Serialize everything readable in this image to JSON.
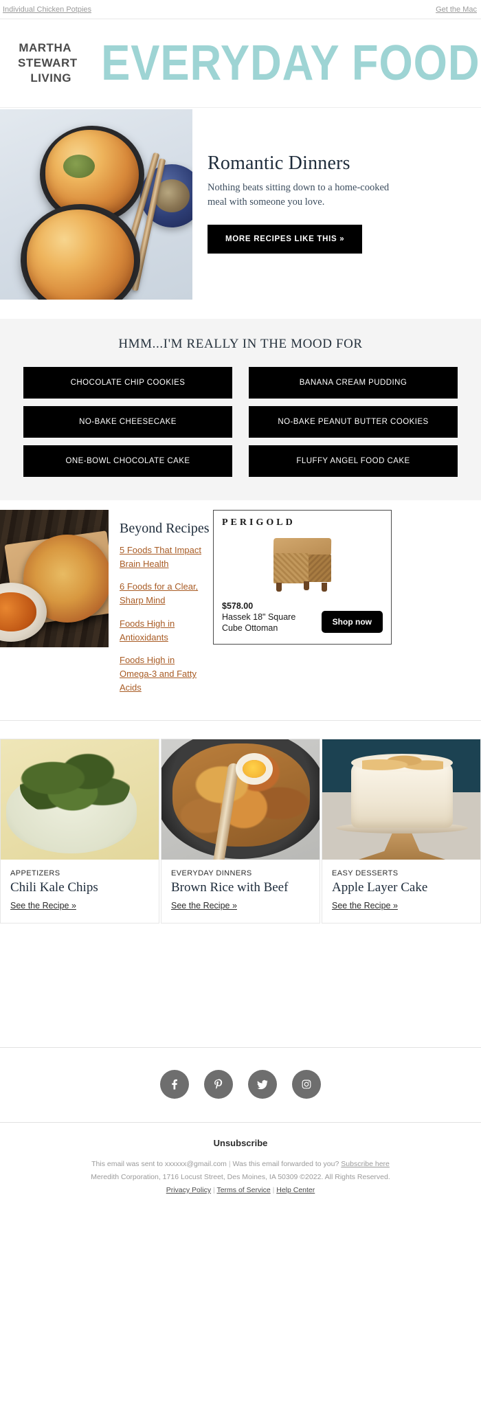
{
  "preheader": {
    "left_text": "Individual Chicken Potpies",
    "right_text": "Get the Mac"
  },
  "masthead": {
    "brand_line1": "MARTHA",
    "brand_line2": "STEWART",
    "brand_line3": "LIVING",
    "publication": "EVERYDAY FOOD",
    "accent_color": "#9ed4d4"
  },
  "hero": {
    "title": "Romantic Dinners",
    "subtitle": "Nothing beats sitting down to a home-cooked meal with someone you love.",
    "cta_label": "MORE RECIPES LIKE THIS »",
    "image_alt": "Individual chicken potpies in cast iron skillets"
  },
  "mood": {
    "heading": "HMM...I'M REALLY IN THE MOOD FOR",
    "buttons": [
      {
        "label": "CHOCOLATE CHIP COOKIES"
      },
      {
        "label": "BANANA CREAM PUDDING"
      },
      {
        "label": "NO-BAKE CHEESECAKE"
      },
      {
        "label": "NO-BAKE PEANUT BUTTER COOKIES"
      },
      {
        "label": "ONE-BOWL CHOCOLATE CAKE"
      },
      {
        "label": "FLUFFY ANGEL FOOD CAKE"
      }
    ]
  },
  "beyond": {
    "title": "Beyond Recipes",
    "image_alt": "Pizza on a wooden board with chicken wings",
    "links": [
      {
        "label": "5 Foods That Impact Brain Health"
      },
      {
        "label": "6 Foods for a Clear, Sharp Mind"
      },
      {
        "label": "Foods High in Antioxidants"
      },
      {
        "label": "Foods High in Omega-3 and Fatty Acids"
      }
    ],
    "link_color": "#a85b24"
  },
  "ad": {
    "brand": "PERIGOLD",
    "price": "$578.00",
    "product_name": "Hassek 18\" Square Cube Ottoman",
    "cta_label": "Shop now",
    "image_alt": "Woven square cube ottoman"
  },
  "cards": [
    {
      "category": "APPETIZERS",
      "title": "Chili Kale Chips",
      "link_label": "See the Recipe »",
      "image_alt": "Kale chips in a bowl"
    },
    {
      "category": "EVERYDAY DINNERS",
      "title": "Brown Rice with Beef",
      "link_label": "See the Recipe »",
      "image_alt": "Brown rice with beef and egg in a skillet"
    },
    {
      "category": "EASY DESSERTS",
      "title": "Apple Layer Cake",
      "link_label": "See the Recipe »",
      "image_alt": "Apple layer cake on a cake stand"
    }
  ],
  "footer": {
    "social": [
      {
        "name": "facebook",
        "label": "Facebook"
      },
      {
        "name": "pinterest",
        "label": "Pinterest"
      },
      {
        "name": "twitter",
        "label": "Twitter"
      },
      {
        "name": "instagram",
        "label": "Instagram"
      }
    ],
    "unsubscribe_label": "Unsubscribe",
    "sent_to_text": "This email was sent to xxxxxx@gmail.com",
    "forwarded_text": "Was this email forwarded to you?",
    "subscribe_link": "Subscribe here",
    "company_text": "Meredith Corporation, 1716 Locust Street, Des Moines, IA 50309 ©2022. All Rights Reserved.",
    "privacy_link": "Privacy Policy",
    "terms_link": "Terms of Service",
    "help_link": "Help Center",
    "separator": "|"
  }
}
